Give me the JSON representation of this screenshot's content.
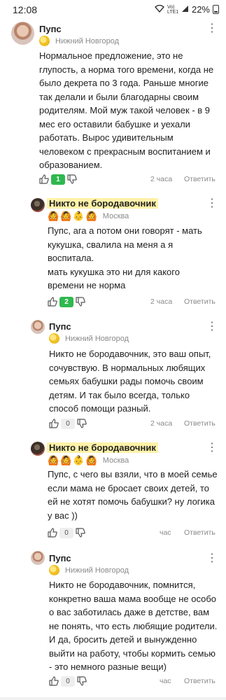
{
  "status_bar": {
    "time": "12:08",
    "network": "Vo) LTE1",
    "battery": "22%"
  },
  "comments": [
    {
      "author": "Пупс",
      "city": "Нижний Новгород",
      "badges": [
        "gold-badge"
      ],
      "text": "Нормальное предложение, это не\nглупость, а норма того времени, когда не\nбыло декрета по 3 года. Раньше многие\nтак делали и были благодарны своим\nродителям. Мой муж такой человек - в 9\nмес его оставили бабушке и уехали\nработать. Вырос удивительным\nчеловеком с прекрасным воспитанием и\nобразованием.",
      "likes": "1",
      "time": "2 часа",
      "reply": "Ответить"
    },
    {
      "author": "Никто не бородавочник",
      "city": "Москва",
      "badges": [
        "🙆",
        "🙆",
        "👶",
        "🙆"
      ],
      "text": "Пупс, ага а потом они говорят - мать\nкукушка, свалила на меня а я\nвоспитала.\nмать кукушка это ни для какого\nвремени не норма",
      "likes": "2",
      "time": "2 часа",
      "reply": "Ответить"
    },
    {
      "author": "Пупс",
      "city": "Нижний Новгород",
      "badges": [
        "gold-badge"
      ],
      "text": "Никто не бородавочник, это ваш опыт,\nсочувствую. В нормальных любящих\nсемьях бабушки рады помочь своим\nдетям. И так было всегда, только\nспособ помощи разный.",
      "likes": "0",
      "time": "2 часа",
      "reply": "Ответить"
    },
    {
      "author": "Никто не бородавочник",
      "city": "Москва",
      "badges": [
        "🙆",
        "🙆",
        "👶",
        "🙆"
      ],
      "text": "Пупс, с чего вы взяли, что в моей семье\nесли мама не бросает своих детей, то\nей не хотят помочь бабушки? ну логика\nу вас ))",
      "likes": "0",
      "time": "час",
      "reply": "Ответить"
    },
    {
      "author": "Пупс",
      "city": "Нижний Новгород",
      "badges": [
        "gold-badge"
      ],
      "text": "Никто не бородавочник, помнится,\nконкретно ваша мама вообще не особо\nо вас заботилась даже в детстве, вам\nне понять, что есть любящие родители.\nИ да, бросить детей и вынужденно\nвыйти на работу, чтобы кормить семью\n- это немного разные вещи)",
      "likes": "0",
      "time": "час",
      "reply": "Ответить"
    }
  ],
  "colors": {
    "likes_positive": "#2fb84f",
    "name_highlight": "#fff2a8",
    "meta": "#8a8a8a"
  },
  "icons": [
    "thumb-up-icon",
    "thumb-down-icon",
    "more-vertical-icon"
  ]
}
